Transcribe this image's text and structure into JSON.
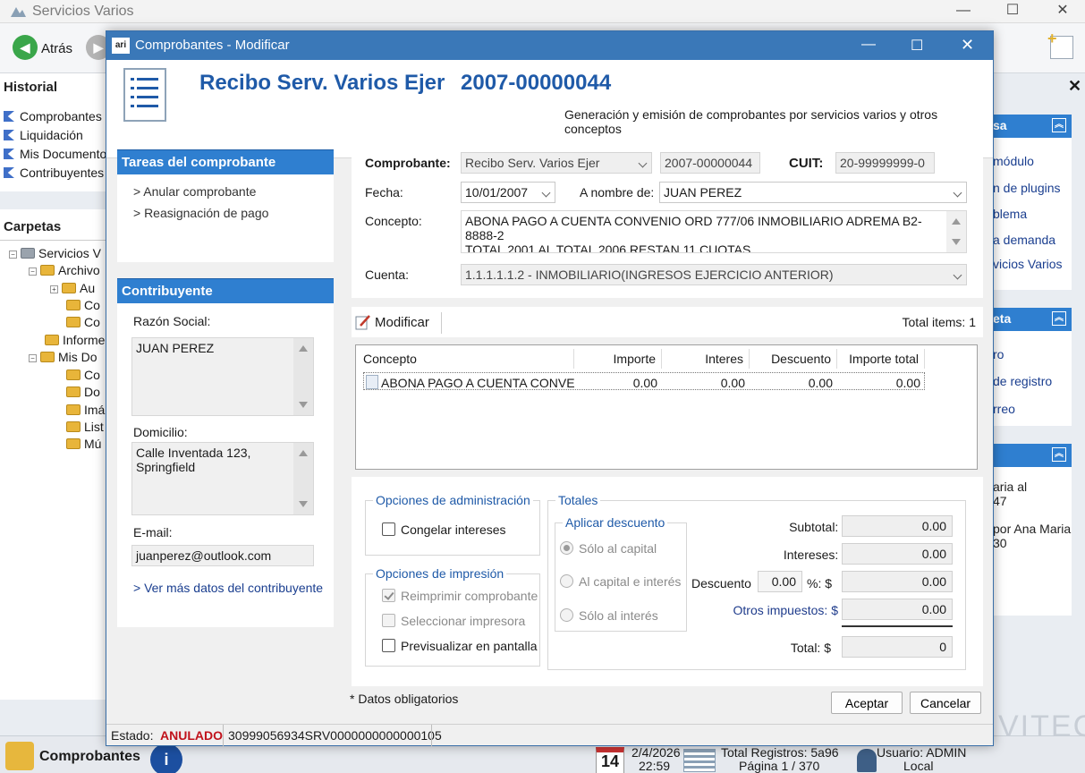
{
  "app": {
    "title": "Servicios Varios"
  },
  "toolbar": {
    "back_label": "Atrás"
  },
  "left_pane": {
    "history_title": "Historial",
    "history_items": [
      "Comprobantes",
      "Liquidación",
      "Mis Documentos",
      "Contribuyentes"
    ],
    "folders_title": "Carpetas",
    "tree": [
      "Servicios V",
      "Archivo",
      "Au",
      "Co",
      "Co",
      "Informe",
      "Mis Do",
      "Co",
      "Do",
      "Imá",
      "List",
      "Mú"
    ]
  },
  "right_pane": {
    "sec1_title": "sa",
    "sec1_links": [
      "módulo",
      "n de plugins",
      "blema",
      "a demanda",
      "vicios Varios"
    ],
    "sec2_title": "eta",
    "sec2_links": [
      "ro",
      "de registro",
      "rreo"
    ],
    "sec3_lines": [
      "aria al",
      "47",
      "por Ana Maria",
      "30"
    ]
  },
  "status_bar": {
    "section": "Comprobantes",
    "day": "14",
    "date": "2/4/2026",
    "time": "22:59",
    "records": "Total Registros: 5a96",
    "page": "Página 1 / 370",
    "user": "Usuario: ADMIN",
    "location": "Local",
    "brand": "VITEC"
  },
  "dialog": {
    "title": "Comprobantes - Modificar",
    "header_title": "Recibo Serv. Varios Ejer",
    "header_number": "2007-00000044",
    "header_subtitle": "Generación y emisión de comprobantes por servicios varios y otros conceptos",
    "tasks_title": "Tareas del comprobante",
    "tasks": [
      "> Anular comprobante",
      "> Reasignación de pago"
    ],
    "contrib_title": "Contribuyente",
    "razon_label": "Razón Social:",
    "razon_value": "JUAN PEREZ",
    "domicilio_label": "Domicilio:",
    "domicilio_value": "Calle Inventada 123, Springfield",
    "email_label": "E-mail:",
    "email_value": "juanperez@outlook.com",
    "more_link": "> Ver más datos del contribuyente",
    "form": {
      "comprobante_label": "Comprobante:",
      "comprobante_value": "Recibo Serv. Varios Ejer",
      "numero_value": "2007-00000044",
      "cuit_label": "CUIT:",
      "cuit_value": "20-99999999-0",
      "fecha_label": "Fecha:",
      "fecha_value": "10/01/2007",
      "nombre_label": "A nombre de:",
      "nombre_value": "JUAN PEREZ",
      "concepto_label": "Concepto:",
      "concepto_line1": "ABONA PAGO A CUENTA CONVENIO ORD 777/06 INMOBILIARIO ADREMA B2-8888-2",
      "concepto_line2": "TOTAL 2001 AL TOTAL 2006 RESTAN 11 CUOTAS",
      "cuenta_label": "Cuenta:",
      "cuenta_value": "1.1.1.1.1.2 - INMOBILIARIO(INGRESOS EJERCICIO ANTERIOR)"
    },
    "items": {
      "modificar_label": "Modificar",
      "total_items": "Total items: 1",
      "columns": [
        "Concepto",
        "Importe",
        "Interes",
        "Descuento",
        "Importe total"
      ],
      "rows": [
        [
          "ABONA PAGO A CUENTA CONVE...",
          "0.00",
          "0.00",
          "0.00",
          "0.00"
        ]
      ]
    },
    "admin": {
      "title": "Opciones de administración",
      "congelar": "Congelar intereses"
    },
    "print": {
      "title": "Opciones de impresión",
      "reimprimir": "Reimprimir comprobante",
      "seleccionar": "Seleccionar impresora",
      "previsualizar": "Previsualizar en pantalla"
    },
    "totales": {
      "title": "Totales",
      "discount_title": "Aplicar descuento",
      "opt1": "Sólo al capital",
      "opt2": "Al capital e interés",
      "opt3": "Sólo al interés",
      "subtotal_label": "Subtotal: $",
      "subtotal": "0.00",
      "intereses_label": "Intereses: $",
      "intereses": "0.00",
      "descuento_label": "Descuento",
      "descuento_pct": "0.00",
      "pct_label": "%: $",
      "descuento": "0.00",
      "otros_label": "Otros impuestos: $",
      "otros": "0.00",
      "total_label": "Total: $",
      "total": "0"
    },
    "required_note": "* Datos obligatorios",
    "accept": "Aceptar",
    "cancel": "Cancelar",
    "estado_label": "Estado:",
    "estado_value": "ANULADO",
    "barcode": "30999056934SRV0000000000000105"
  }
}
